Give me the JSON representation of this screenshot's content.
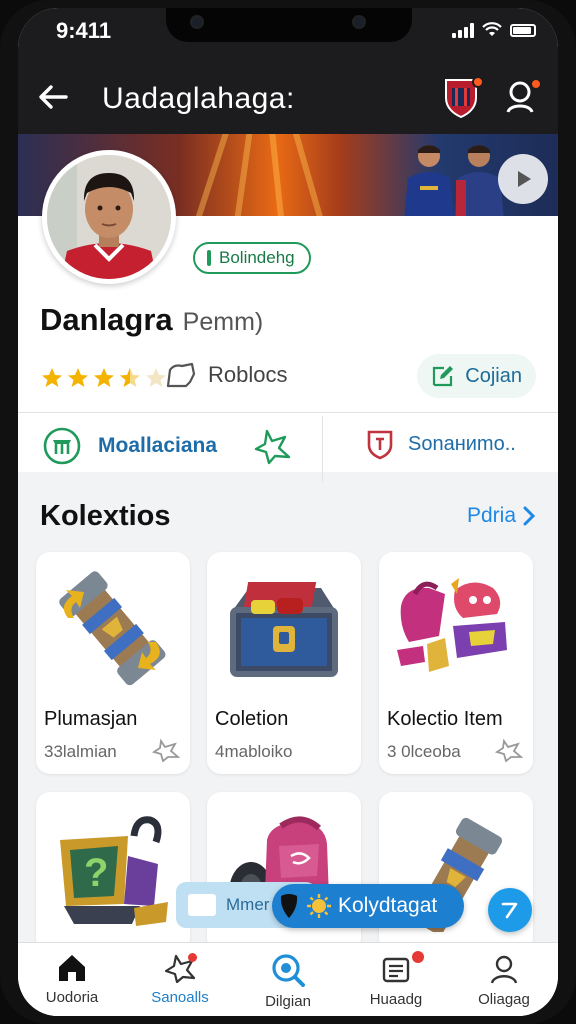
{
  "status_bar": {
    "time": "9:411"
  },
  "header": {
    "title": "Uadaglahaga:"
  },
  "profile": {
    "status_chip": "Bolindehg",
    "name": "Danlagra",
    "subname": "Pemm)",
    "rating": 3.5,
    "rating_max": 5,
    "roblocs_label": "Roblocs",
    "edit_label": "Cojian",
    "link_left_label": "Moallaciana",
    "link_right_label": "Sonaниmo.."
  },
  "collections": {
    "title": "Kolextios",
    "see_all": "Pdria",
    "items": [
      {
        "title": "Plumasjan",
        "subtitle": "33lalmian"
      },
      {
        "title": "Coletion",
        "subtitle": "4mabloiko"
      },
      {
        "title": "Kolectio Item",
        "subtitle": "3 0lceoba"
      },
      {
        "title": "",
        "subtitle": ""
      },
      {
        "title": "",
        "subtitle": ""
      },
      {
        "title": "",
        "subtitle": ""
      }
    ]
  },
  "floating": {
    "light_pill": "Mmer",
    "dark_pill": "Kolydtagat"
  },
  "tabs": [
    {
      "label": "Uodoria"
    },
    {
      "label": "Sanoalls"
    },
    {
      "label": "Dilgian"
    },
    {
      "label": "Huaadg"
    },
    {
      "label": "Oliagag"
    }
  ],
  "colors": {
    "accent_blue": "#1e88e5",
    "green": "#1f9a5b",
    "star": "#f5b301",
    "dark_header": "#1c1c1e"
  }
}
